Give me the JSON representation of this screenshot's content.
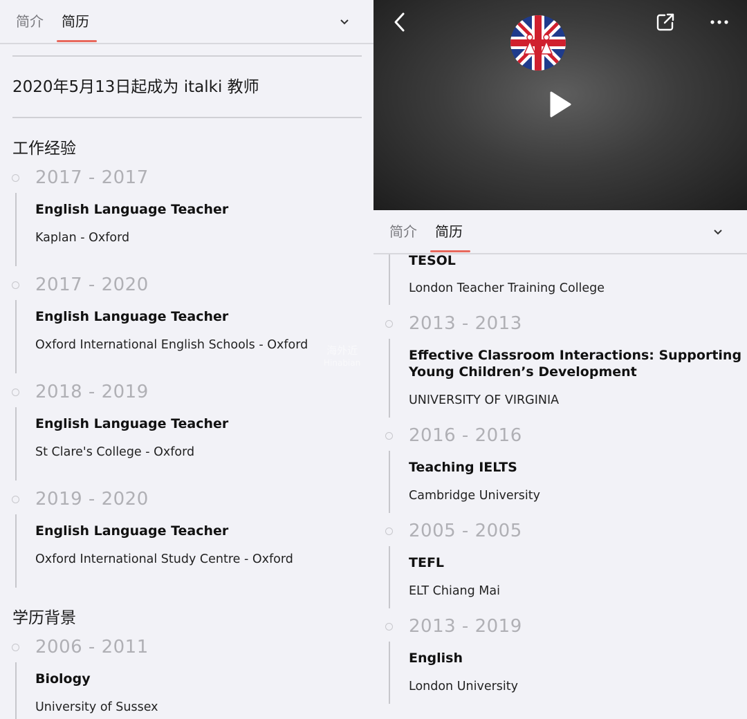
{
  "tabs": {
    "intro": "简介",
    "resume": "简历"
  },
  "left": {
    "teacher_since": "2020年5月13日起成为 italki 教师",
    "work_title": "工作经验",
    "work": [
      {
        "years": "2017 - 2017",
        "role": "English Language Teacher",
        "org": "Kaplan - Oxford"
      },
      {
        "years": "2017 - 2020",
        "role": "English Language Teacher",
        "org": "Oxford International English Schools - Oxford"
      },
      {
        "years": "2018 - 2019",
        "role": "English Language Teacher",
        "org": "St Clare's College - Oxford"
      },
      {
        "years": "2019 - 2020",
        "role": "English Language Teacher",
        "org": "Oxford International Study Centre - Oxford"
      }
    ],
    "edu_title": "学历背景",
    "edu": [
      {
        "years": "2006 - 2011",
        "role": "Biology",
        "org": "University of Sussex"
      }
    ]
  },
  "right": {
    "partial": {
      "role": "TESOL",
      "org": "London Teacher Training College"
    },
    "certs": [
      {
        "years": "2013 - 2013",
        "role_line1": "Effective Classroom Interactions: Supporting",
        "role_line2": "Young Children’s Development",
        "org": "UNIVERSITY OF VIRGINIA"
      },
      {
        "years": "2016 - 2016",
        "role": "Teaching IELTS",
        "org": "Cambridge University"
      },
      {
        "years": "2005 - 2005",
        "role": "TEFL",
        "org": "ELT Chiang Mai"
      },
      {
        "years": "2013 - 2019",
        "role": "English",
        "org": "London University"
      }
    ]
  },
  "watermark": {
    "line1": "海外近",
    "line2": "Hinabian"
  },
  "icons": {
    "back": "chevron-left-icon",
    "share": "share-external-icon",
    "more": "ellipsis-icon",
    "play": "play-icon",
    "avatar": "union-jack-avatar",
    "dropdown": "chevron-down-icon"
  },
  "colors": {
    "accent": "#e8685c",
    "background": "#f2f2f7",
    "muted": "#b0b0b5"
  }
}
